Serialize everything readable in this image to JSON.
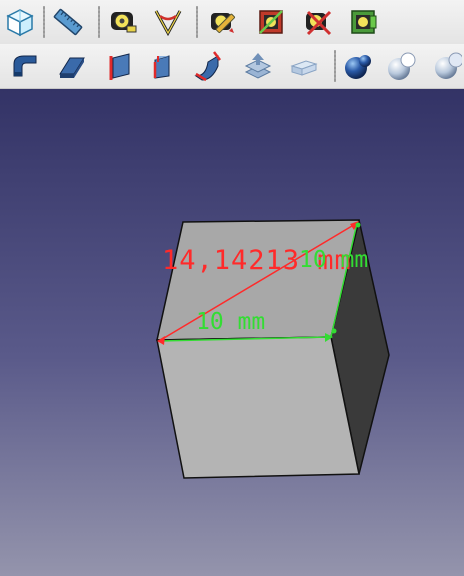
{
  "toolbar_top": {
    "buttons": [
      {
        "icon": "isometric-view-icon"
      },
      {
        "icon": "measure-distance-icon"
      },
      {
        "icon": "measure-linear-icon"
      },
      {
        "icon": "measure-angular-icon"
      },
      {
        "icon": "measure-refresh-icon"
      },
      {
        "icon": "measure-clear-icon"
      },
      {
        "icon": "measure-toggle-3d-icon"
      },
      {
        "icon": "measure-toggle-delta-icon"
      }
    ]
  },
  "toolbar_bottom": {
    "buttons": [
      {
        "icon": "extrude-icon"
      },
      {
        "icon": "revolve-icon"
      },
      {
        "icon": "mirror-icon"
      },
      {
        "icon": "fillet-icon"
      },
      {
        "icon": "chamfer-icon"
      },
      {
        "icon": "make-face-icon"
      },
      {
        "icon": "ruled-surface-icon"
      },
      {
        "icon": "loft-icon"
      },
      {
        "icon": "boolean-icon"
      },
      {
        "icon": "cut-icon"
      },
      {
        "icon": "fuse-icon"
      }
    ]
  },
  "viewport": {
    "measurements": {
      "diagonal_label": "14,14213 mm",
      "edge_label": "10 mm",
      "edge_vertical_label": "10 mm"
    },
    "colors": {
      "diagonal": "#ff2a2a",
      "edge": "#33dd33",
      "cube_front": "#b4b4b4",
      "cube_top": "#a8a8a8",
      "cube_side": "#3a3a3a"
    }
  }
}
